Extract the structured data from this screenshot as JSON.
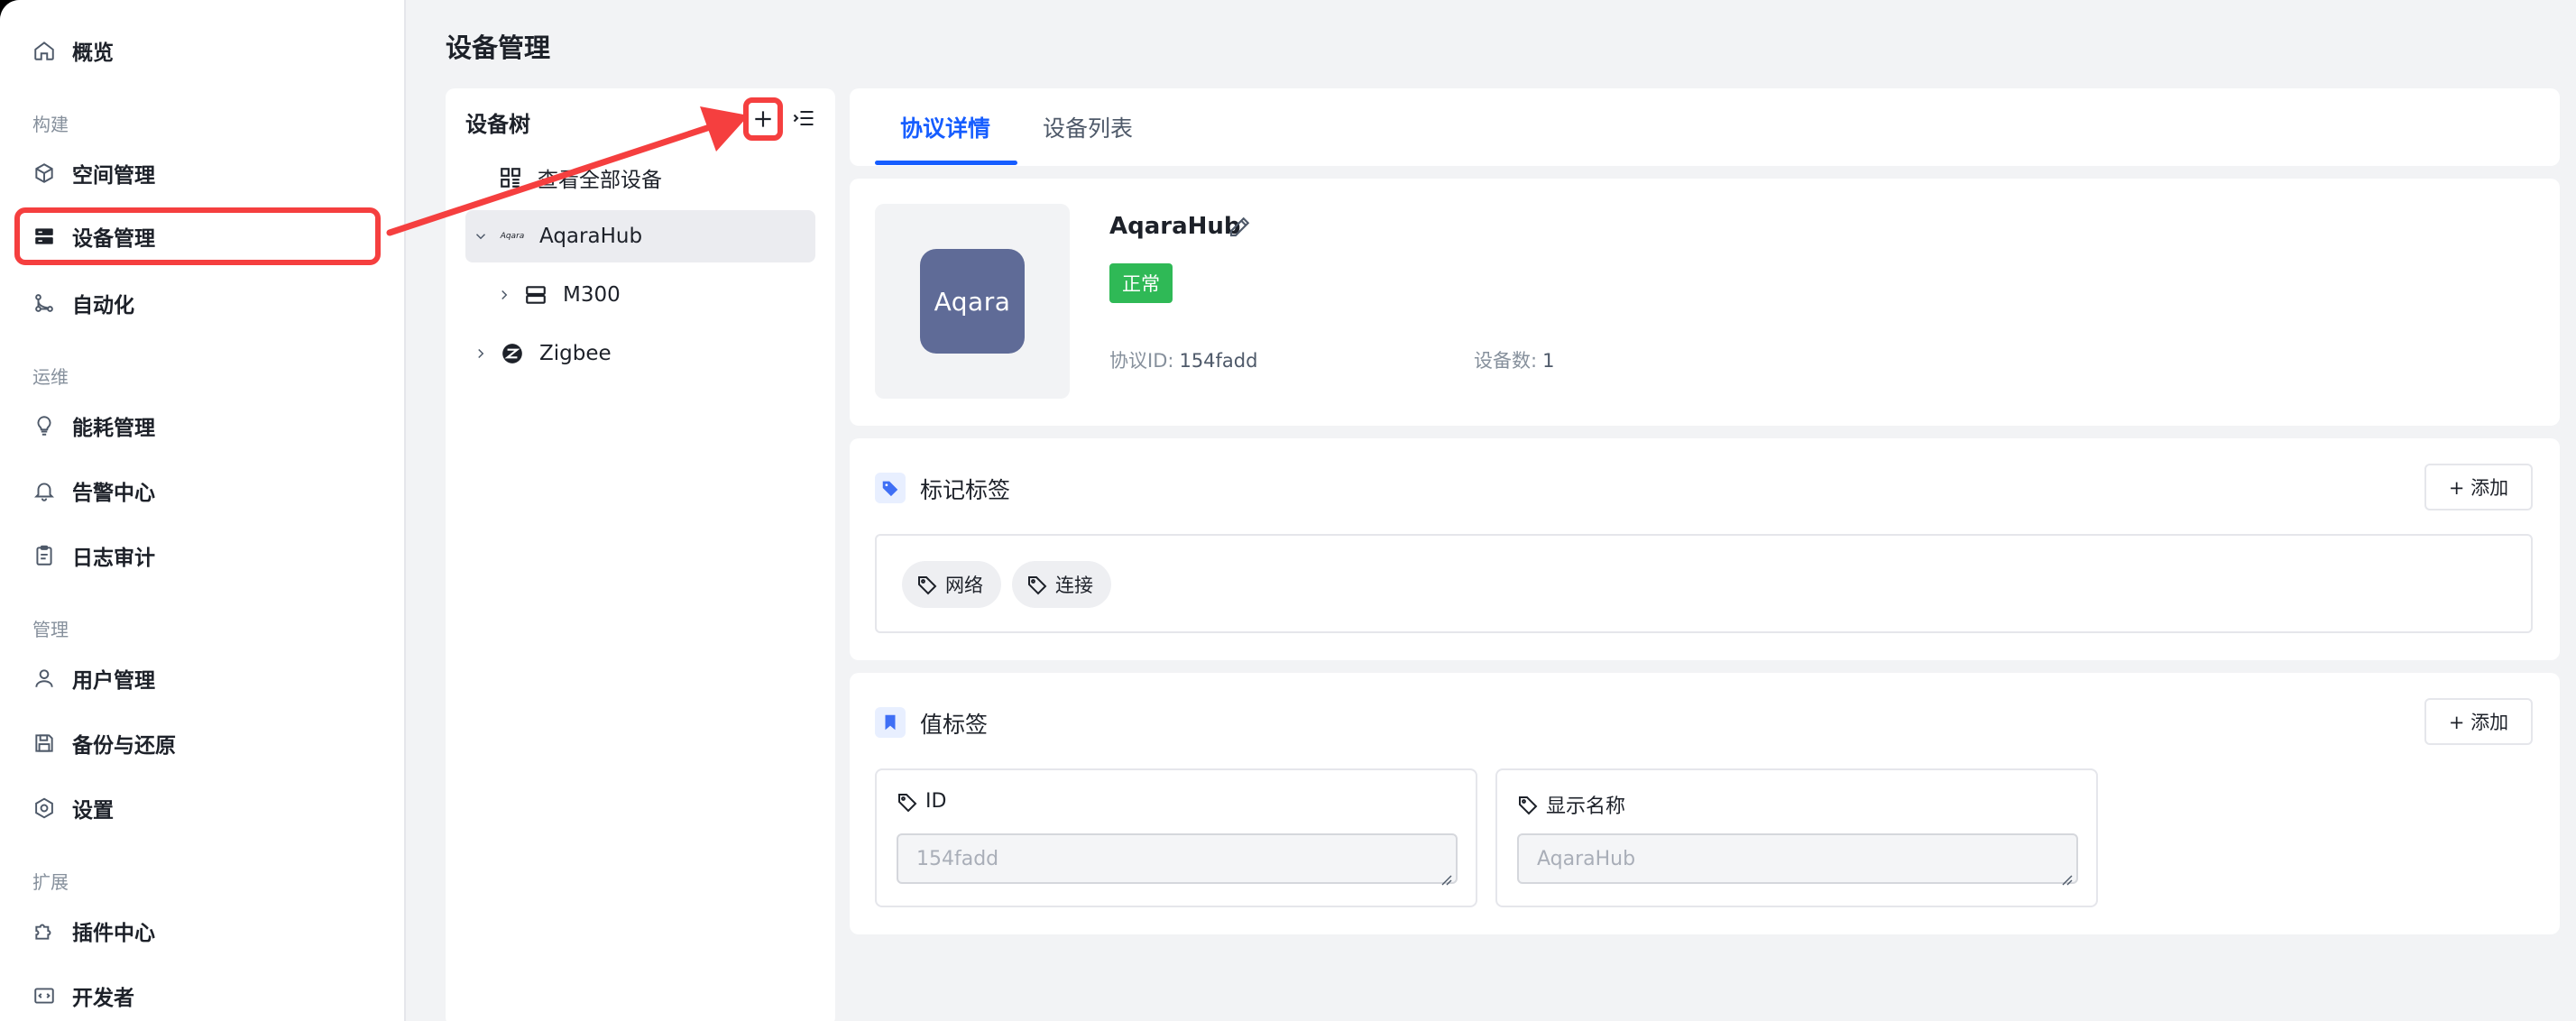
{
  "sidebar": {
    "items": [
      {
        "label": "概览",
        "icon": "home-icon"
      },
      {
        "section": "构建"
      },
      {
        "label": "空间管理",
        "icon": "cube-icon"
      },
      {
        "label": "设备管理",
        "icon": "server-icon",
        "active": true
      },
      {
        "label": "自动化",
        "icon": "flow-icon"
      },
      {
        "section": "运维"
      },
      {
        "label": "能耗管理",
        "icon": "bulb-icon"
      },
      {
        "label": "告警中心",
        "icon": "bell-icon"
      },
      {
        "label": "日志审计",
        "icon": "clipboard-icon"
      },
      {
        "section": "管理"
      },
      {
        "label": "用户管理",
        "icon": "user-icon"
      },
      {
        "label": "备份与还原",
        "icon": "save-icon"
      },
      {
        "label": "设置",
        "icon": "settings-icon"
      },
      {
        "section": "扩展"
      },
      {
        "label": "插件中心",
        "icon": "puzzle-icon"
      },
      {
        "label": "开发者",
        "icon": "code-icon"
      }
    ]
  },
  "header": {
    "title": "设备管理"
  },
  "tree": {
    "title": "设备树",
    "rows": [
      {
        "label": "查看全部设备"
      },
      {
        "label": "AqaraHub",
        "icon_text": "Aqara"
      },
      {
        "label": "M300"
      },
      {
        "label": "Zigbee"
      }
    ]
  },
  "tabs": [
    {
      "label": "协议详情",
      "active": true
    },
    {
      "label": "设备列表",
      "active": false
    }
  ],
  "protocol": {
    "logo_text": "Aqara",
    "name": "AqaraHub",
    "status": "正常",
    "status_color": "#2fb956",
    "id_label": "协议ID:",
    "id_value": "154fadd",
    "count_label": "设备数:",
    "count_value": "1"
  },
  "mark_tags": {
    "title": "标记标签",
    "add_label": "+ 添加",
    "chips": [
      "网络",
      "连接"
    ]
  },
  "value_tags": {
    "title": "值标签",
    "add_label": "+ 添加",
    "fields": [
      {
        "label": "ID",
        "value": "154fadd"
      },
      {
        "label": "显示名称",
        "value": "AqaraHub"
      }
    ]
  },
  "colors": {
    "accent": "#165dff",
    "highlight": "#f53f3f"
  }
}
